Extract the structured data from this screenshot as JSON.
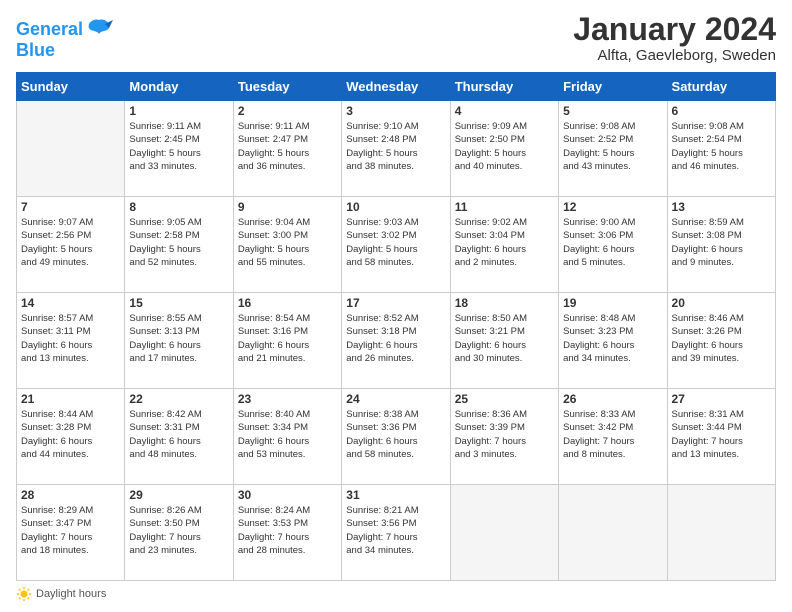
{
  "logo": {
    "line1": "General",
    "line2": "Blue"
  },
  "title": "January 2024",
  "location": "Alfta, Gaevleborg, Sweden",
  "days_of_week": [
    "Sunday",
    "Monday",
    "Tuesday",
    "Wednesday",
    "Thursday",
    "Friday",
    "Saturday"
  ],
  "weeks": [
    [
      {
        "day": "",
        "info": ""
      },
      {
        "day": "1",
        "info": "Sunrise: 9:11 AM\nSunset: 2:45 PM\nDaylight: 5 hours\nand 33 minutes."
      },
      {
        "day": "2",
        "info": "Sunrise: 9:11 AM\nSunset: 2:47 PM\nDaylight: 5 hours\nand 36 minutes."
      },
      {
        "day": "3",
        "info": "Sunrise: 9:10 AM\nSunset: 2:48 PM\nDaylight: 5 hours\nand 38 minutes."
      },
      {
        "day": "4",
        "info": "Sunrise: 9:09 AM\nSunset: 2:50 PM\nDaylight: 5 hours\nand 40 minutes."
      },
      {
        "day": "5",
        "info": "Sunrise: 9:08 AM\nSunset: 2:52 PM\nDaylight: 5 hours\nand 43 minutes."
      },
      {
        "day": "6",
        "info": "Sunrise: 9:08 AM\nSunset: 2:54 PM\nDaylight: 5 hours\nand 46 minutes."
      }
    ],
    [
      {
        "day": "7",
        "info": "Sunrise: 9:07 AM\nSunset: 2:56 PM\nDaylight: 5 hours\nand 49 minutes."
      },
      {
        "day": "8",
        "info": "Sunrise: 9:05 AM\nSunset: 2:58 PM\nDaylight: 5 hours\nand 52 minutes."
      },
      {
        "day": "9",
        "info": "Sunrise: 9:04 AM\nSunset: 3:00 PM\nDaylight: 5 hours\nand 55 minutes."
      },
      {
        "day": "10",
        "info": "Sunrise: 9:03 AM\nSunset: 3:02 PM\nDaylight: 5 hours\nand 58 minutes."
      },
      {
        "day": "11",
        "info": "Sunrise: 9:02 AM\nSunset: 3:04 PM\nDaylight: 6 hours\nand 2 minutes."
      },
      {
        "day": "12",
        "info": "Sunrise: 9:00 AM\nSunset: 3:06 PM\nDaylight: 6 hours\nand 5 minutes."
      },
      {
        "day": "13",
        "info": "Sunrise: 8:59 AM\nSunset: 3:08 PM\nDaylight: 6 hours\nand 9 minutes."
      }
    ],
    [
      {
        "day": "14",
        "info": "Sunrise: 8:57 AM\nSunset: 3:11 PM\nDaylight: 6 hours\nand 13 minutes."
      },
      {
        "day": "15",
        "info": "Sunrise: 8:55 AM\nSunset: 3:13 PM\nDaylight: 6 hours\nand 17 minutes."
      },
      {
        "day": "16",
        "info": "Sunrise: 8:54 AM\nSunset: 3:16 PM\nDaylight: 6 hours\nand 21 minutes."
      },
      {
        "day": "17",
        "info": "Sunrise: 8:52 AM\nSunset: 3:18 PM\nDaylight: 6 hours\nand 26 minutes."
      },
      {
        "day": "18",
        "info": "Sunrise: 8:50 AM\nSunset: 3:21 PM\nDaylight: 6 hours\nand 30 minutes."
      },
      {
        "day": "19",
        "info": "Sunrise: 8:48 AM\nSunset: 3:23 PM\nDaylight: 6 hours\nand 34 minutes."
      },
      {
        "day": "20",
        "info": "Sunrise: 8:46 AM\nSunset: 3:26 PM\nDaylight: 6 hours\nand 39 minutes."
      }
    ],
    [
      {
        "day": "21",
        "info": "Sunrise: 8:44 AM\nSunset: 3:28 PM\nDaylight: 6 hours\nand 44 minutes."
      },
      {
        "day": "22",
        "info": "Sunrise: 8:42 AM\nSunset: 3:31 PM\nDaylight: 6 hours\nand 48 minutes."
      },
      {
        "day": "23",
        "info": "Sunrise: 8:40 AM\nSunset: 3:34 PM\nDaylight: 6 hours\nand 53 minutes."
      },
      {
        "day": "24",
        "info": "Sunrise: 8:38 AM\nSunset: 3:36 PM\nDaylight: 6 hours\nand 58 minutes."
      },
      {
        "day": "25",
        "info": "Sunrise: 8:36 AM\nSunset: 3:39 PM\nDaylight: 7 hours\nand 3 minutes."
      },
      {
        "day": "26",
        "info": "Sunrise: 8:33 AM\nSunset: 3:42 PM\nDaylight: 7 hours\nand 8 minutes."
      },
      {
        "day": "27",
        "info": "Sunrise: 8:31 AM\nSunset: 3:44 PM\nDaylight: 7 hours\nand 13 minutes."
      }
    ],
    [
      {
        "day": "28",
        "info": "Sunrise: 8:29 AM\nSunset: 3:47 PM\nDaylight: 7 hours\nand 18 minutes."
      },
      {
        "day": "29",
        "info": "Sunrise: 8:26 AM\nSunset: 3:50 PM\nDaylight: 7 hours\nand 23 minutes."
      },
      {
        "day": "30",
        "info": "Sunrise: 8:24 AM\nSunset: 3:53 PM\nDaylight: 7 hours\nand 28 minutes."
      },
      {
        "day": "31",
        "info": "Sunrise: 8:21 AM\nSunset: 3:56 PM\nDaylight: 7 hours\nand 34 minutes."
      },
      {
        "day": "",
        "info": ""
      },
      {
        "day": "",
        "info": ""
      },
      {
        "day": "",
        "info": ""
      }
    ]
  ],
  "footer": {
    "daylight_label": "Daylight hours"
  }
}
